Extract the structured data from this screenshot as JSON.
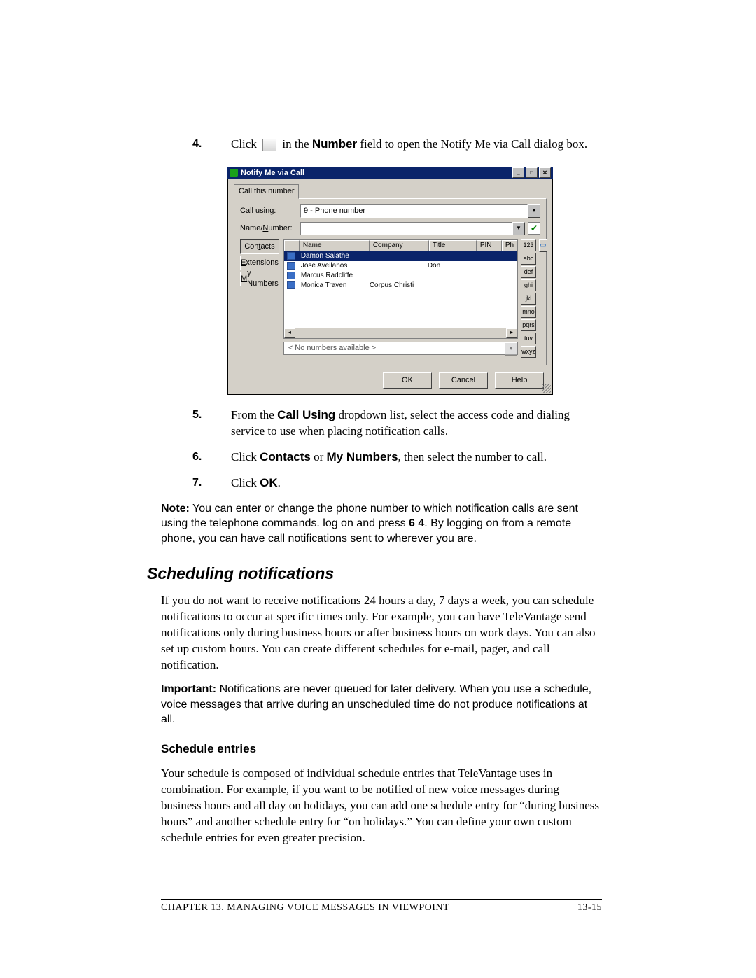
{
  "steps": {
    "s4": {
      "num": "4.",
      "pre": "Click",
      "mid": "in the",
      "bold1": "Number",
      "post": "field to open the Notify Me via Call dialog box."
    },
    "s5": {
      "num": "5.",
      "pre": "From the",
      "bold1": "Call Using",
      "post": "dropdown list, select the access code and dialing service to use when placing notification calls."
    },
    "s6": {
      "num": "6.",
      "pre": "Click",
      "bold1": "Contacts",
      "mid": "or",
      "bold2": "My Numbers",
      "post": ", then select the number to call."
    },
    "s7": {
      "num": "7.",
      "pre": "Click",
      "bold1": "OK",
      "post": "."
    }
  },
  "dialog": {
    "title": "Notify Me via Call",
    "tab": "Call this number",
    "labels": {
      "call_using": "Call using:",
      "name_number": "Name/Number:"
    },
    "call_using_value": "9 - Phone number",
    "side_tabs": {
      "contacts": "Contacts",
      "extensions": "Extensions",
      "my_numbers": "My Numbers"
    },
    "cols": {
      "name": "Name",
      "company": "Company",
      "title": "Title",
      "pin": "PIN",
      "ph": "Ph"
    },
    "rows": [
      {
        "name": "Damon Salathe",
        "company": "",
        "title": "",
        "selected": true
      },
      {
        "name": "Jose Avellanos",
        "company": "",
        "title": "Don"
      },
      {
        "name": "Marcus Radcliffe",
        "company": "",
        "title": ""
      },
      {
        "name": "Monica Traven",
        "company": "Corpus Christi",
        "title": ""
      }
    ],
    "keypad": [
      "123",
      "abc",
      "def",
      "ghi",
      "jkl",
      "mno",
      "pqrs",
      "tuv",
      "wxyz"
    ],
    "no_numbers": "< No numbers available >",
    "buttons": {
      "ok": "OK",
      "cancel": "Cancel",
      "help": "Help"
    }
  },
  "note": {
    "label": "Note:",
    "t1": "You can enter or change the phone number to which notification calls are sent using the telephone commands. log on and press",
    "keys": "6 4",
    "t2": ". By logging on from a remote phone, you can have call notifications sent to wherever you are."
  },
  "section": {
    "heading": "Scheduling notifications",
    "p1": "If you do not want to receive notifications 24 hours a day, 7 days a week, you can schedule notifications to occur at specific times only. For example, you can have TeleVantage send notifications only during business hours or after business hours on work days. You can also set up custom hours. You can create different schedules for e-mail, pager, and call notification.",
    "important_label": "Important:",
    "important_text": "Notifications are never queued for later delivery. When you use a schedule, voice messages that arrive during an unscheduled time do not produce notifications at all.",
    "sub_heading": "Schedule entries",
    "p2": "Your schedule is composed of individual schedule entries that TeleVantage uses in combination. For example, if you want to be notified of new voice messages during business hours and all day on holidays, you can add one schedule entry for “during business hours” and another schedule entry for “on holidays.” You can define your own custom schedule entries for even greater precision."
  },
  "footer": {
    "left_a": "Chapter 13. M",
    "left_b": "anaging",
    "left_c": " V",
    "left_d": "oice",
    "left_e": " M",
    "left_f": "essages in",
    "left_g": " V",
    "left_h": "iew",
    "left_i": "P",
    "left_j": "oint",
    "right": "13-15"
  }
}
